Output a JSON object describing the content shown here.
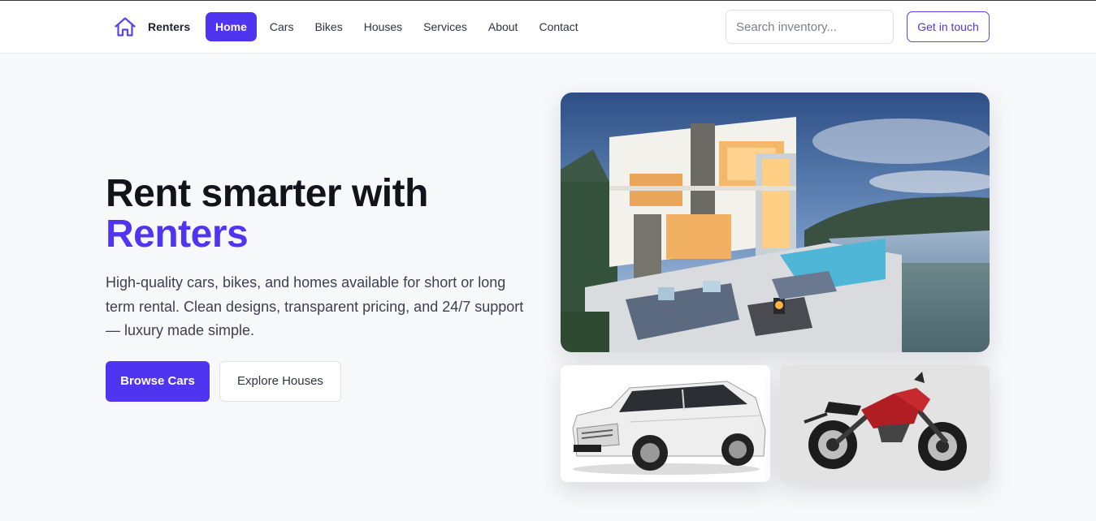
{
  "header": {
    "brand": "Renters",
    "nav": [
      {
        "label": "Home",
        "active": true
      },
      {
        "label": "Cars"
      },
      {
        "label": "Bikes"
      },
      {
        "label": "Houses"
      },
      {
        "label": "Services"
      },
      {
        "label": "About"
      },
      {
        "label": "Contact"
      }
    ],
    "search_placeholder": "Search inventory...",
    "cta_label": "Get in touch"
  },
  "hero": {
    "title_line1": "Rent smarter with",
    "title_accent": "Renters",
    "subtitle": "High-quality cars, bikes, and homes available for short or long term rental. Clean designs, transparent pricing, and 24/7 support — luxury made simple.",
    "primary_button": "Browse Cars",
    "secondary_button": "Explore Houses"
  },
  "gallery": {
    "images": [
      "luxury-villa-with-pool",
      "white-suv",
      "red-motorcycle"
    ],
    "car_plate": "Travelsen"
  },
  "colors": {
    "accent": "#4f34f0",
    "text_dark": "#12141c",
    "background": "#f7f8fa"
  }
}
